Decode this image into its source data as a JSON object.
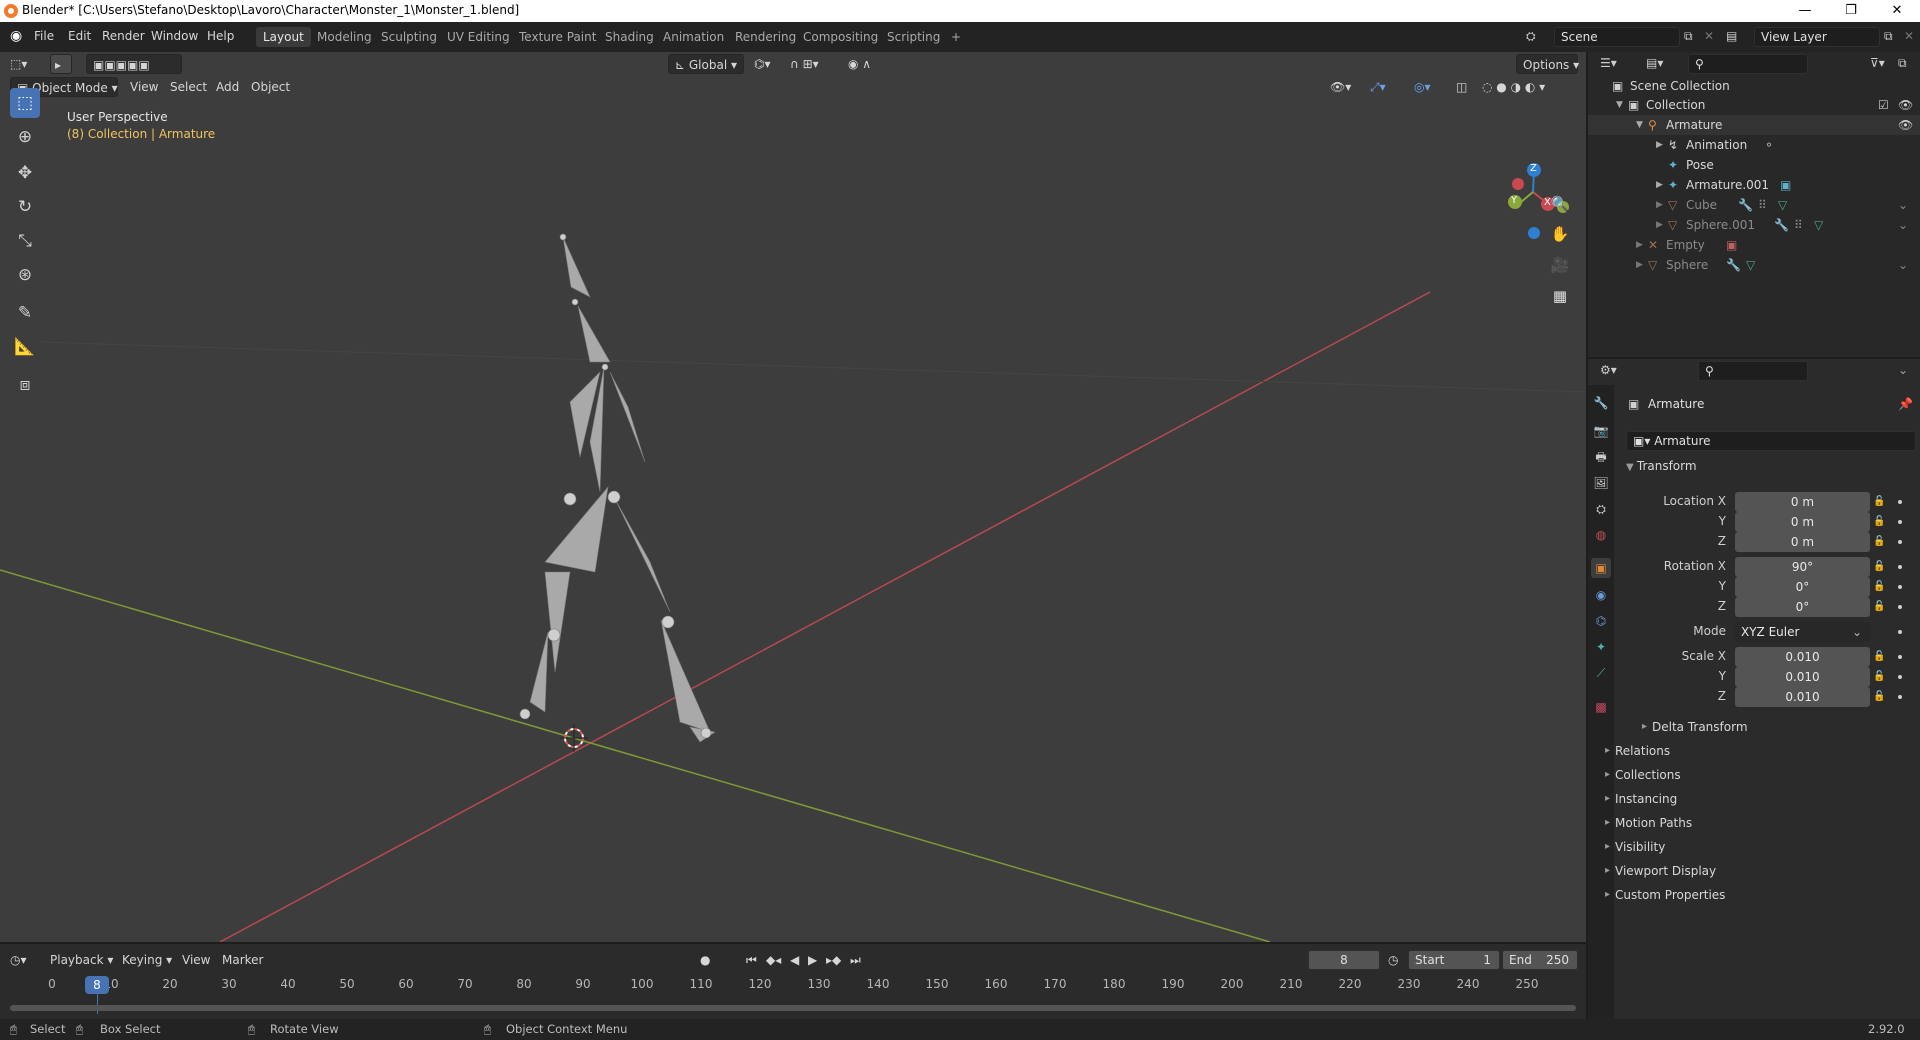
{
  "window": {
    "title": "Blender* [C:\\Users\\Stefano\\Desktop\\Lavoro\\Character\\Monster_1\\Monster_1.blend]",
    "controls": [
      "—",
      "❐",
      "✕"
    ]
  },
  "menu": [
    "File",
    "Edit",
    "Render",
    "Window",
    "Help"
  ],
  "workspaces": [
    "Layout",
    "Modeling",
    "Sculpting",
    "UV Editing",
    "Texture Paint",
    "Shading",
    "Animation",
    "Rendering",
    "Compositing",
    "Scripting"
  ],
  "workspace_add": "+",
  "scene": {
    "name": "Scene",
    "view_layer": "View Layer"
  },
  "viewport": {
    "transform_orientation": "Global",
    "options_label": "Options",
    "header_menus": [
      "View",
      "Select",
      "Add",
      "Object"
    ],
    "mode": "Object Mode",
    "overlay_title": "User Perspective",
    "overlay_context": "(8) Collection | Armature",
    "gizmo_axes": {
      "x": "X",
      "y": "Y",
      "z": "Z"
    }
  },
  "toolbar_icons": [
    "select-box-icon",
    "cursor-icon",
    "move-icon",
    "rotate-icon",
    "scale-icon",
    "transform-icon",
    "annotate-icon",
    "measure-icon",
    "add-cube-icon"
  ],
  "outliner": {
    "root": "Scene Collection",
    "items": [
      {
        "label": "Collection",
        "level": 0,
        "color": "#d8d8d8"
      },
      {
        "label": "Armature",
        "level": 1,
        "color": "#d8d8d8"
      },
      {
        "label": "Animation",
        "level": 2,
        "color": "#d8d8d8"
      },
      {
        "label": "Pose",
        "level": 2,
        "color": "#d8d8d8"
      },
      {
        "label": "Armature.001",
        "level": 2,
        "color": "#d8d8d8"
      },
      {
        "label": "Cube",
        "level": 2,
        "color": "#8a8a8a"
      },
      {
        "label": "Sphere.001",
        "level": 2,
        "color": "#8a8a8a"
      },
      {
        "label": "Empty",
        "level": 1,
        "color": "#8a8a8a"
      },
      {
        "label": "Sphere",
        "level": 1,
        "color": "#8a8a8a"
      }
    ]
  },
  "properties": {
    "object_name": "Armature",
    "object_field": "Armature",
    "transform_title": "Transform",
    "location": {
      "label": "Location X",
      "x": "0 m",
      "y": "0 m",
      "z": "0 m"
    },
    "rotation": {
      "label": "Rotation X",
      "x": "90°",
      "y": "0°",
      "z": "0°"
    },
    "mode": {
      "label": "Mode",
      "value": "XYZ Euler"
    },
    "scale": {
      "label": "Scale X",
      "x": "0.010",
      "y": "0.010",
      "z": "0.010"
    },
    "axis_labels": {
      "y": "Y",
      "z": "Z"
    },
    "delta": "Delta Transform",
    "panels": [
      "Relations",
      "Collections",
      "Instancing",
      "Motion Paths",
      "Visibility",
      "Viewport Display",
      "Custom Properties"
    ]
  },
  "timeline": {
    "menus": [
      "Playback",
      "Keying",
      "View",
      "Marker"
    ],
    "current_frame": "8",
    "start_label": "Start",
    "start": "1",
    "end_label": "End",
    "end": "250",
    "ticks": [
      "0",
      "10",
      "20",
      "30",
      "40",
      "50",
      "60",
      "70",
      "80",
      "90",
      "100",
      "110",
      "120",
      "130",
      "140",
      "150",
      "160",
      "170",
      "180",
      "190",
      "200",
      "210",
      "220",
      "230",
      "240",
      "250"
    ],
    "playhead": "8"
  },
  "status": {
    "select": "Select",
    "box_select": "Box Select",
    "rotate_view": "Rotate View",
    "context_menu": "Object Context Menu",
    "version": "2.92.0"
  },
  "colors": {
    "accent": "#4772b3",
    "x_axis": "#c8494f",
    "y_axis": "#8ba83a",
    "z_axis": "#2f7fd3",
    "selected_text": "#f0c35e"
  }
}
